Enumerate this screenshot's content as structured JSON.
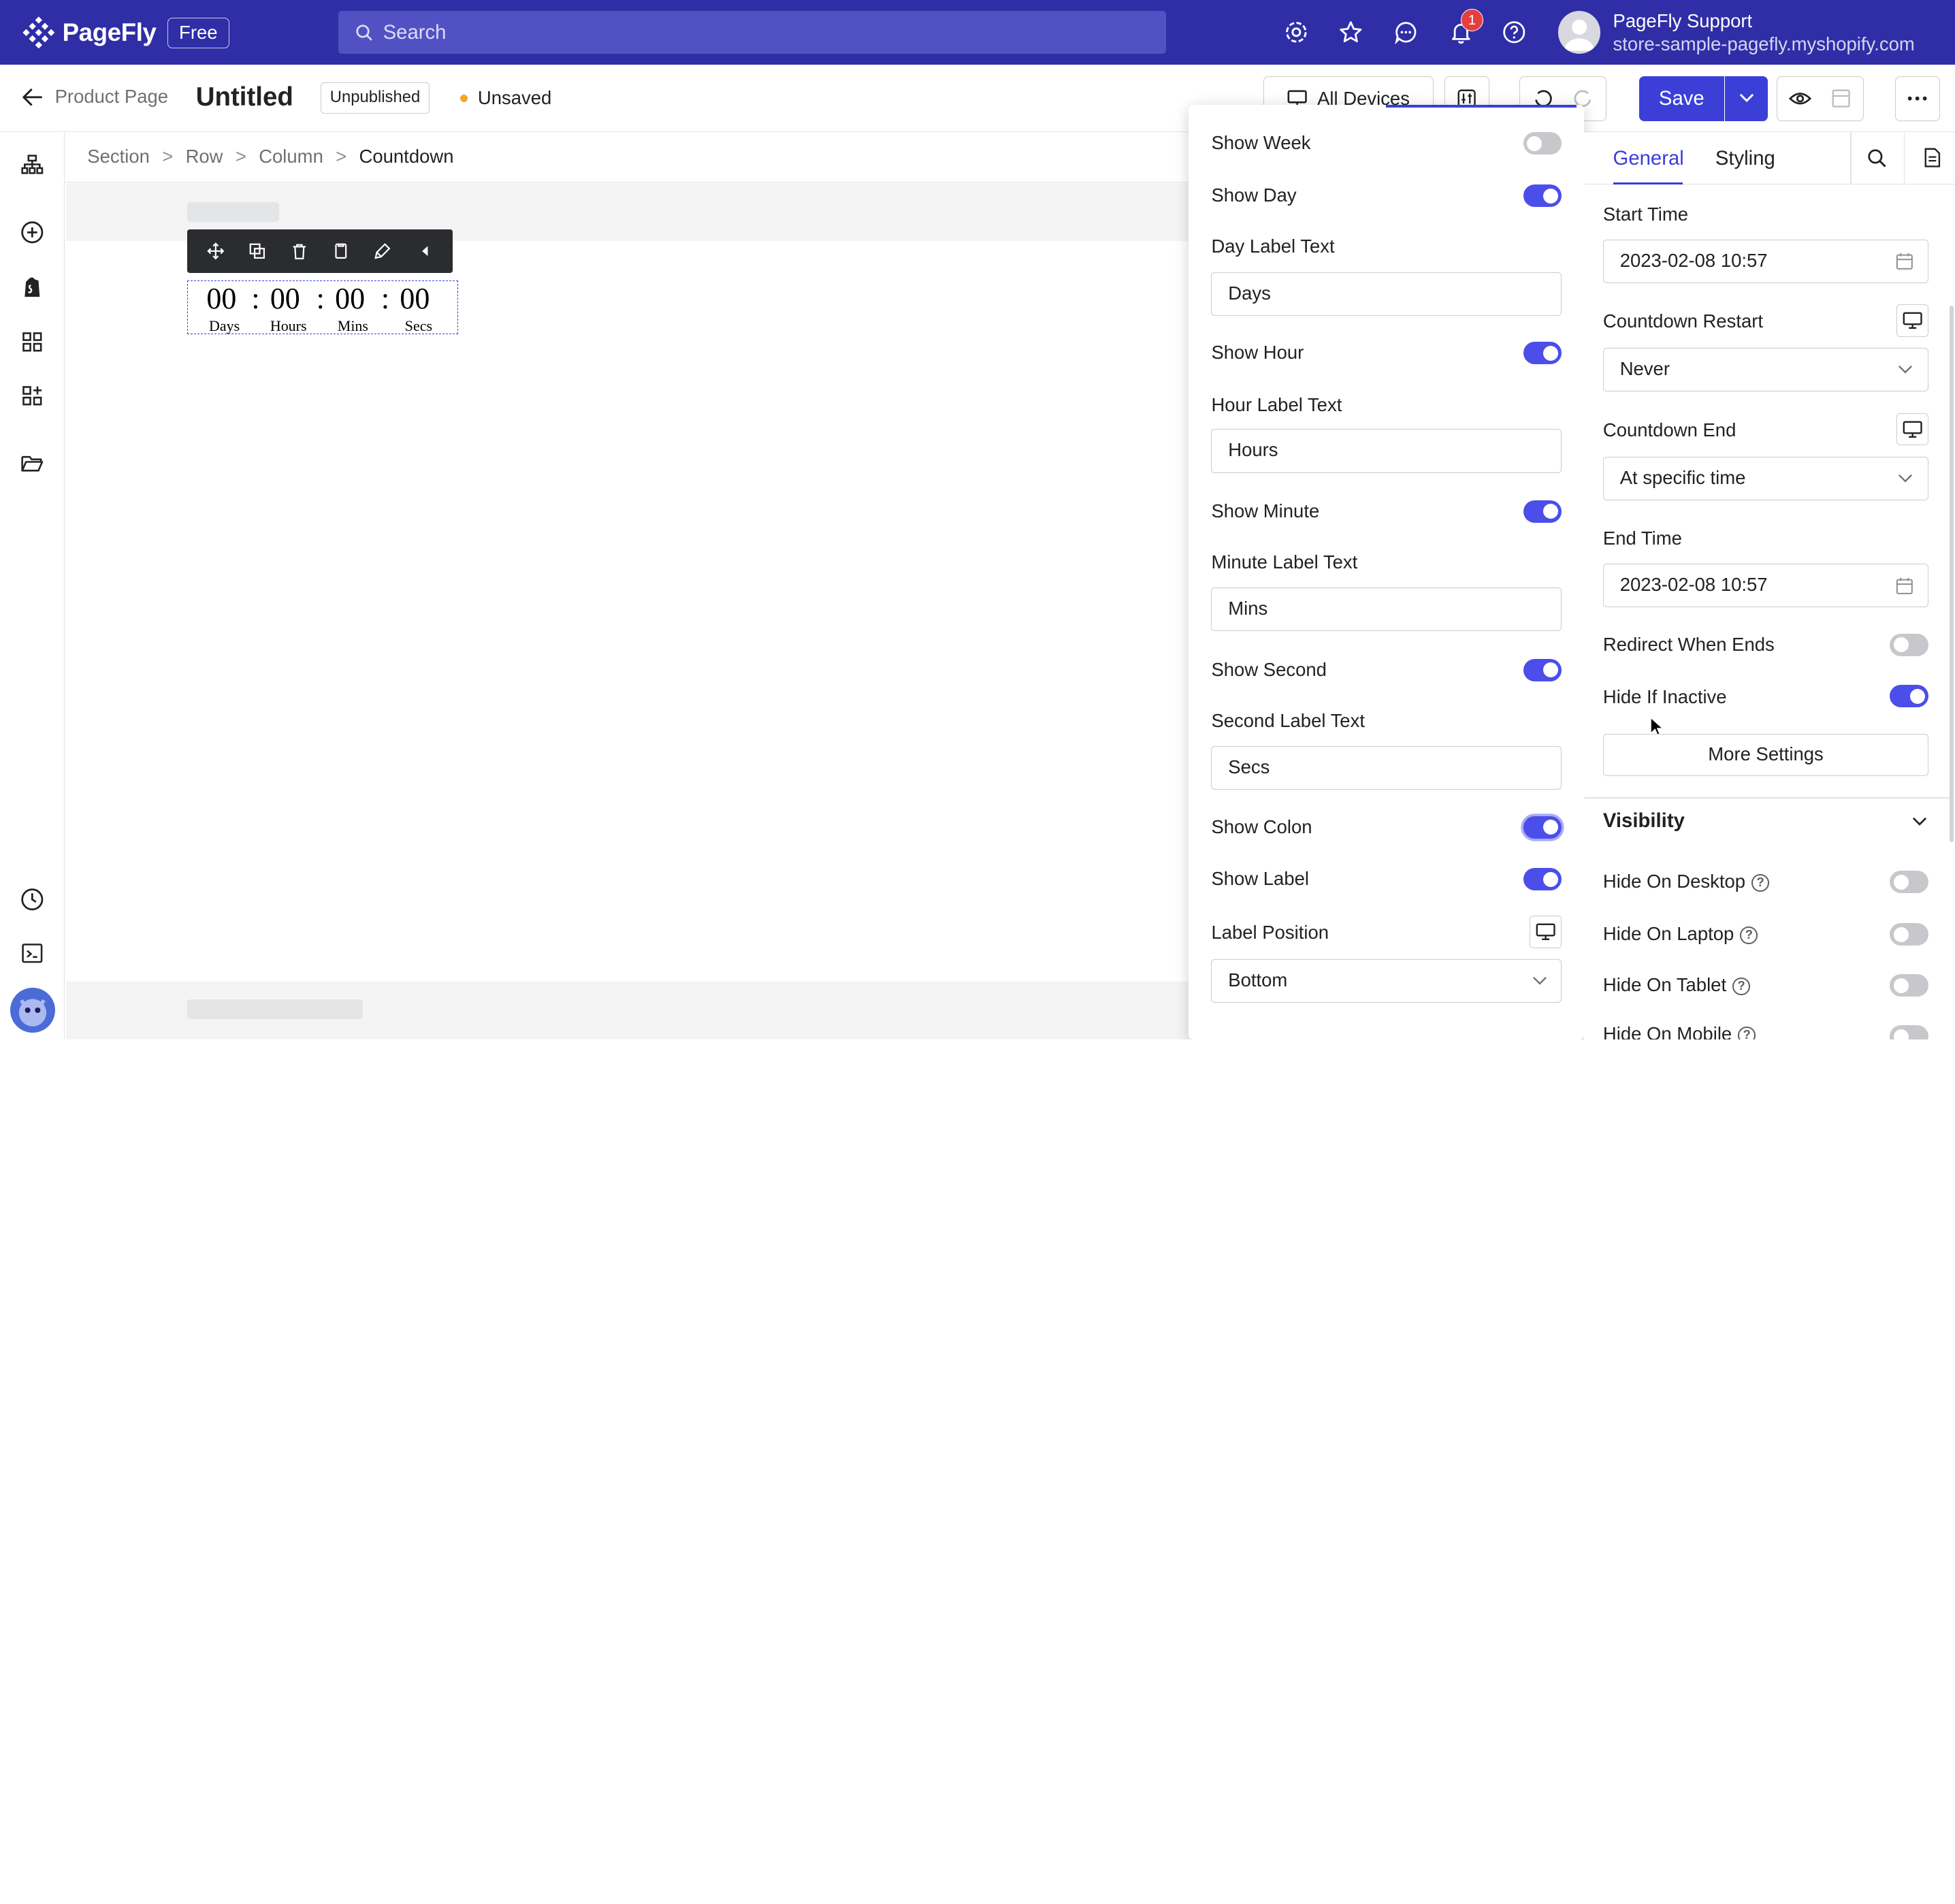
{
  "app": {
    "logo_text": "PageFly",
    "plan_badge": "Free"
  },
  "topbar": {
    "search_placeholder": "Search",
    "notification_count": "1",
    "account_name": "PageFly Support",
    "account_store": "store-sample-pagefly.myshopify.com",
    "icons": [
      "settings-icon",
      "star-icon",
      "chat-icon",
      "bell-icon",
      "help-icon"
    ]
  },
  "header": {
    "back_label": "Product Page",
    "page_title": "Untitled",
    "publish_status": "Unpublished",
    "save_status": "Unsaved",
    "device_label": "All Devices",
    "save_label": "Save"
  },
  "breadcrumb": [
    "Section",
    "Row",
    "Column",
    "Countdown"
  ],
  "countdown_preview": {
    "values": [
      "00",
      "00",
      "00",
      "00"
    ],
    "labels": [
      "Days",
      "Hours",
      "Mins",
      "Secs"
    ],
    "separator": ":"
  },
  "popover": {
    "show_week": {
      "label": "Show Week",
      "on": false
    },
    "show_day": {
      "label": "Show Day",
      "on": true
    },
    "day_label": {
      "label": "Day Label Text",
      "value": "Days"
    },
    "show_hour": {
      "label": "Show Hour",
      "on": true
    },
    "hour_label": {
      "label": "Hour Label Text",
      "value": "Hours"
    },
    "show_minute": {
      "label": "Show Minute",
      "on": true
    },
    "minute_label": {
      "label": "Minute Label Text",
      "value": "Mins"
    },
    "show_second": {
      "label": "Show Second",
      "on": true
    },
    "second_label": {
      "label": "Second Label Text",
      "value": "Secs"
    },
    "show_colon": {
      "label": "Show Colon",
      "on": true
    },
    "show_label": {
      "label": "Show Label",
      "on": true
    },
    "label_position": {
      "label": "Label Position",
      "value": "Bottom"
    }
  },
  "rpanel": {
    "tabs": [
      "General",
      "Styling"
    ],
    "start_time": {
      "label": "Start Time",
      "value": "2023-02-08 10:57"
    },
    "countdown_restart": {
      "label": "Countdown Restart",
      "value": "Never"
    },
    "countdown_end": {
      "label": "Countdown End",
      "value": "At specific time"
    },
    "end_time": {
      "label": "End Time",
      "value": "2023-02-08 10:57"
    },
    "redirect_when_ends": {
      "label": "Redirect When Ends",
      "on": false
    },
    "hide_if_inactive": {
      "label": "Hide If Inactive",
      "on": true
    },
    "more_settings": "More Settings",
    "visibility": {
      "title": "Visibility",
      "items": [
        {
          "label": "Hide On Desktop",
          "on": false
        },
        {
          "label": "Hide On Laptop",
          "on": false
        },
        {
          "label": "Hide On Tablet",
          "on": false
        },
        {
          "label": "Hide On Mobile",
          "on": false
        }
      ]
    }
  },
  "colors": {
    "brand": "#2f2ea7",
    "accent": "#3b3fd8",
    "toggle_on": "#4b4ee8"
  }
}
